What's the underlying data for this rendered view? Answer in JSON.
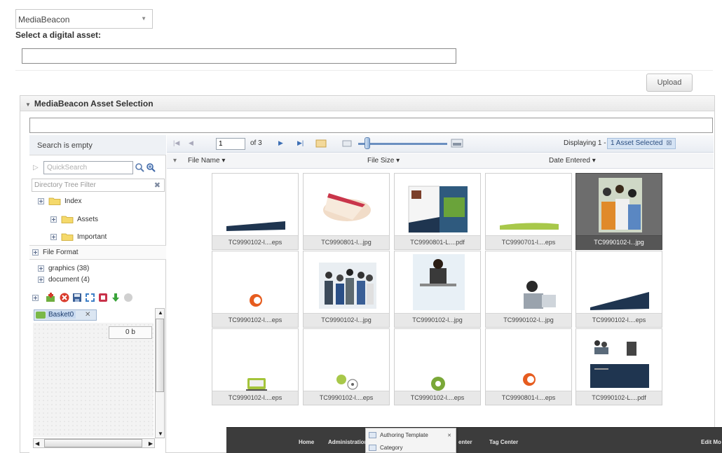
{
  "source_dropdown": {
    "value": "MediaBeacon"
  },
  "select_asset_label": "Select a digital asset:",
  "upload_button": "Upload",
  "panel": {
    "title": "MediaBeacon Asset Selection"
  },
  "left_panel": {
    "search_status": "Search is empty",
    "quick_search_placeholder": "QuickSearch",
    "directory_filter_placeholder": "Directory Tree Filter",
    "tree": [
      {
        "label": "Index"
      },
      {
        "label": "Assets"
      },
      {
        "label": "Important"
      }
    ],
    "file_format": {
      "header": "File Format",
      "items": [
        "graphics (38)",
        "document (4)"
      ]
    },
    "basket": {
      "tab_label": "Basket0",
      "size": "0 b"
    }
  },
  "pager": {
    "page": "1",
    "of_label": "of 3",
    "displaying": "Displaying 1 - 15",
    "selected_badge": "1 Asset Selected"
  },
  "columns": [
    "File Name",
    "File Size",
    "Date Entered"
  ],
  "assets": [
    {
      "name": "TC9990102-l....eps",
      "kind": "wave",
      "selected": false
    },
    {
      "name": "TC9990801-l...jpg",
      "kind": "cake",
      "selected": false
    },
    {
      "name": "TC9990801-L....pdf",
      "kind": "brochure",
      "selected": false
    },
    {
      "name": "TC9990701-l....eps",
      "kind": "greenwave",
      "selected": false
    },
    {
      "name": "TC9990102-l...jpg",
      "kind": "people-photo",
      "selected": true
    },
    {
      "name": "TC9990102-l....eps",
      "kind": "logo-c",
      "selected": false
    },
    {
      "name": "TC9990102-l...jpg",
      "kind": "group-photo",
      "selected": false
    },
    {
      "name": "TC9990102-l...jpg",
      "kind": "woman-laptop",
      "selected": false
    },
    {
      "name": "TC9990102-l...jpg",
      "kind": "man-laptop",
      "selected": false
    },
    {
      "name": "TC9990102-l....eps",
      "kind": "wave2",
      "selected": false
    },
    {
      "name": "TC9990102-l....eps",
      "kind": "green-laptop",
      "selected": false
    },
    {
      "name": "TC9990102-l....eps",
      "kind": "green-cd",
      "selected": false
    },
    {
      "name": "TC9990102-l....eps",
      "kind": "green-disc",
      "selected": false
    },
    {
      "name": "TC9990801-l....eps",
      "kind": "logo-c2",
      "selected": false
    },
    {
      "name": "TC9990102-L....pdf",
      "kind": "brochure2",
      "selected": false
    }
  ],
  "overlay": {
    "nav": [
      "Home",
      "Administration",
      "enter",
      "Tag Center",
      "Edit Mo"
    ],
    "menu": [
      "Authoring Template",
      "Category"
    ]
  },
  "colors": {
    "accent": "#5f83b2",
    "selected_thumb": "#6d6d6d",
    "navy": "#1f3550",
    "lime": "#a8c84a"
  }
}
